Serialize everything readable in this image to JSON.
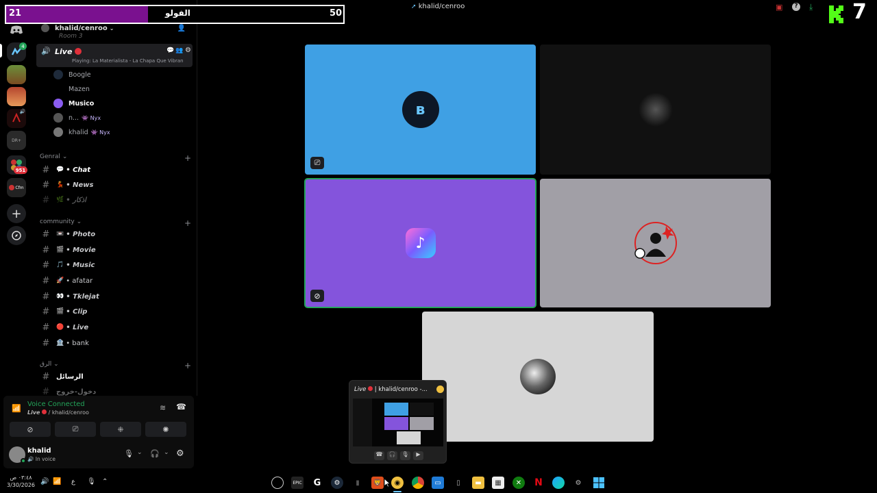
{
  "overlay": {
    "left_count": "21",
    "label": "الفولو",
    "right_count": "50"
  },
  "window": {
    "title": "khalid/cenroo",
    "brand_text": "7"
  },
  "rail": {
    "mention_badge": "951",
    "cfm_label": "Cfm",
    "dm_badge": "4",
    "elite_label": "DR+"
  },
  "server": {
    "name": "khalid/cenroo",
    "prev_channel": "Room 3"
  },
  "voice_channel": {
    "name": "Live",
    "activity": "Playing: La Materialista - La Chapa Que Vibran",
    "members": [
      {
        "name": "Boogle",
        "badge": ""
      },
      {
        "name": "Mazen",
        "badge": ""
      },
      {
        "name": "Musico",
        "badge": ""
      },
      {
        "name": "n...",
        "badge": "Nyx"
      },
      {
        "name": "khalid",
        "badge": "Nyx"
      }
    ]
  },
  "categories": {
    "genral": "Genral",
    "community": "community",
    "other": "الرق"
  },
  "channels_genral": [
    {
      "emoji": "💬",
      "name": "• Chat"
    },
    {
      "emoji": "💃",
      "name": "• News"
    },
    {
      "emoji": "🌿",
      "name": "• اذكار"
    }
  ],
  "channels_community": [
    {
      "emoji": "📼",
      "name": "• Photo"
    },
    {
      "emoji": "🎬",
      "name": "• Movie"
    },
    {
      "emoji": "🎵",
      "name": "• Music"
    },
    {
      "emoji": "🚀",
      "name": "• afatar"
    },
    {
      "emoji": "👀",
      "name": "• Tklejat"
    },
    {
      "emoji": "🎬",
      "name": "• Clip"
    },
    {
      "emoji": "🔴",
      "name": "• Live"
    },
    {
      "emoji": "🏦",
      "name": "• bank"
    }
  ],
  "channels_other": [
    {
      "name": "الرسائل"
    },
    {
      "name": "دخول-خروج"
    }
  ],
  "voice_status": {
    "title": "Voice Connected",
    "channel_name": "Live",
    "server_name": "/ khalid/cenroo"
  },
  "user": {
    "name": "khalid",
    "status": "In voice"
  },
  "popup": {
    "title_channel": "Live",
    "title_rest": "| khalid/cenroo -..."
  },
  "clock": {
    "time": "٠٣:٤٨ ص",
    "date": "3/30/2026"
  },
  "taskbar": {
    "lang": "ع"
  },
  "colors": {
    "tile_blue": "#3fa0e4",
    "tile_purple": "#8454dc",
    "tile_gray": "#a19fa6",
    "tile_light": "#d6d6d6",
    "tile_dark": "#111111",
    "overlay_purple": "#7a118f",
    "voice_green": "#23a55a",
    "red": "#e0303a"
  }
}
